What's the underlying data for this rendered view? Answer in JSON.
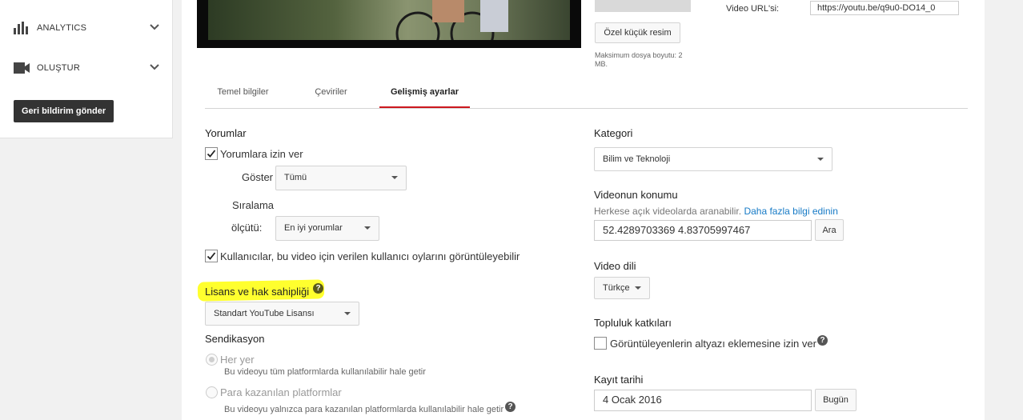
{
  "sidebar": {
    "analytics_label": "ANALYTICS",
    "create_label": "OLUŞTUR",
    "feedback_button": "Geri bildirim gönder"
  },
  "thumbnail": {
    "custom_button": "Özel küçük resim",
    "max_size_note": "Maksimum dosya boyutu: 2 MB."
  },
  "video_url": {
    "label": "Video URL'si:",
    "value": "https://youtu.be/q9u0-DO14_0"
  },
  "tabs": [
    {
      "label": "Temel bilgiler",
      "active": false
    },
    {
      "label": "Çeviriler",
      "active": false
    },
    {
      "label": "Gelişmiş ayarlar",
      "active": true
    }
  ],
  "comments": {
    "heading": "Yorumlar",
    "allow_label": "Yorumlara izin ver",
    "allow_checked": true,
    "show_label": "Göster",
    "show_value": "Tümü",
    "sort_label_1": "Sıralama",
    "sort_label_2": "ölçütü:",
    "sort_value": "En iyi yorumlar",
    "ratings_label": "Kullanıcılar, bu video için verilen kullanıcı oylarını görüntüleyebilir",
    "ratings_checked": true
  },
  "license": {
    "heading": "Lisans ve hak sahipliği",
    "value": "Standart YouTube Lisansı"
  },
  "syndication": {
    "heading": "Sendikasyon",
    "options": [
      {
        "label": "Her yer",
        "desc": "Bu videoyu tüm platformlarda kullanılabilir hale getir",
        "selected": true
      },
      {
        "label": "Para kazanılan platformlar",
        "desc": "Bu videoyu yalnızca para kazanılan platformlarda kullanılabilir hale getir",
        "selected": false
      }
    ]
  },
  "category": {
    "heading": "Kategori",
    "value": "Bilim ve Teknoloji"
  },
  "location": {
    "heading": "Videonun konumu",
    "desc": "Herkese açık videolarda aranabilir.",
    "link": "Daha fazla bilgi edinin",
    "value": "52.4289703369 4.83705997467",
    "search_button": "Ara"
  },
  "language": {
    "heading": "Video dili",
    "value": "Türkçe"
  },
  "community": {
    "heading": "Topluluk katkıları",
    "subtitles_label": "Görüntüleyenlerin altyazı eklemesine izin ver",
    "subtitles_checked": false
  },
  "recording_date": {
    "heading": "Kayıt tarihi",
    "value": "4 Ocak 2016",
    "today_button": "Bugün"
  },
  "colors": {
    "accent_red": "#cc181e",
    "highlight_yellow": "#ffff2e",
    "link_blue": "#167ac6"
  }
}
